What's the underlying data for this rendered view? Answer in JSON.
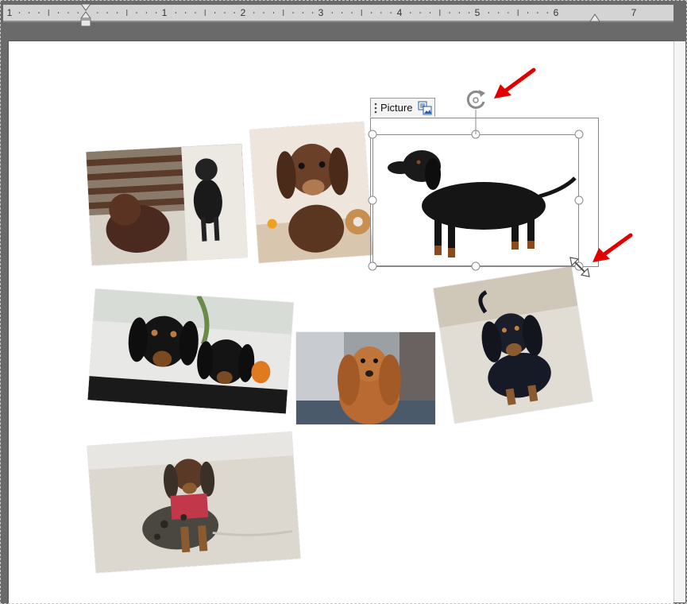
{
  "ruler": {
    "labels": [
      "1",
      "1",
      "2",
      "3",
      "4",
      "5",
      "6",
      "7"
    ]
  },
  "selection": {
    "anchor_label": "Picture"
  },
  "icons": {
    "rotate": "rotate-handle-icon",
    "resize": "resize-diagonal-icon",
    "picture_layout": "picture-layout-icon",
    "arrow": "red-arrow-icon"
  },
  "colors": {
    "app_background": "#6a6a6a",
    "ruler": "#d4d4d4",
    "page": "#ffffff",
    "selection": "#8a8a8a",
    "annotation_arrow": "#e00000"
  },
  "photos": [
    "photo-two-dogs-on-balcony",
    "photo-brown-dachshund-puppy",
    "photo-black-dachshund-standing",
    "photo-two-black-tan-puppies",
    "photo-long-haired-dachshund",
    "photo-dachshund-on-sofa",
    "photo-dapple-dachshund-on-sand"
  ]
}
